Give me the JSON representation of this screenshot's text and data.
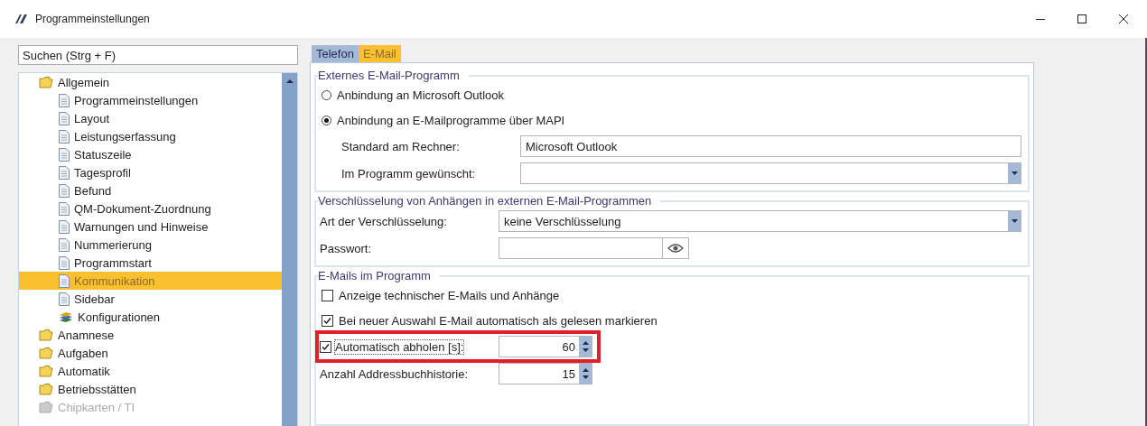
{
  "window": {
    "title": "Programmeinstellungen"
  },
  "search": {
    "placeholder": "Suchen (Strg + F)"
  },
  "tree": [
    {
      "label": "Allgemein",
      "kind": "folder",
      "selected": false,
      "disabled": false,
      "children": [
        {
          "label": "Programmeinstellungen",
          "kind": "page",
          "selected": false,
          "disabled": false
        },
        {
          "label": "Layout",
          "kind": "page",
          "selected": false,
          "disabled": false
        },
        {
          "label": "Leistungserfassung",
          "kind": "page",
          "selected": false,
          "disabled": false
        },
        {
          "label": "Statuszeile",
          "kind": "page",
          "selected": false,
          "disabled": false
        },
        {
          "label": "Tagesprofil",
          "kind": "page",
          "selected": false,
          "disabled": false
        },
        {
          "label": "Befund",
          "kind": "page",
          "selected": false,
          "disabled": false
        },
        {
          "label": "QM-Dokument-Zuordnung",
          "kind": "page",
          "selected": false,
          "disabled": false
        },
        {
          "label": "Warnungen und Hinweise",
          "kind": "page",
          "selected": false,
          "disabled": false
        },
        {
          "label": "Nummerierung",
          "kind": "page",
          "selected": false,
          "disabled": false
        },
        {
          "label": "Programmstart",
          "kind": "page",
          "selected": false,
          "disabled": false
        },
        {
          "label": "Kommunikation",
          "kind": "page",
          "selected": true,
          "disabled": false
        },
        {
          "label": "Sidebar",
          "kind": "page",
          "selected": false,
          "disabled": false
        },
        {
          "label": "Konfigurationen",
          "kind": "stack",
          "selected": false,
          "disabled": false
        }
      ]
    },
    {
      "label": "Anamnese",
      "kind": "folder",
      "selected": false,
      "disabled": false
    },
    {
      "label": "Aufgaben",
      "kind": "folder",
      "selected": false,
      "disabled": false
    },
    {
      "label": "Automatik",
      "kind": "folder",
      "selected": false,
      "disabled": false
    },
    {
      "label": "Betriebsstätten",
      "kind": "folder",
      "selected": false,
      "disabled": false
    },
    {
      "label": "Chipkarten / TI",
      "kind": "folder",
      "selected": false,
      "disabled": true
    }
  ],
  "tabs": [
    {
      "label": "Telefon",
      "selected": false
    },
    {
      "label": "E-Mail",
      "selected": true
    }
  ],
  "groups": [
    {
      "title": "Externes E-Mail-Programm",
      "rows": [
        {
          "kind": "radio",
          "label": "Anbindung an Microsoft Outlook",
          "selected": false
        },
        {
          "kind": "radio",
          "label": "Anbindung an E-Mailprogramme über MAPI",
          "selected": true
        },
        {
          "kind": "field",
          "label": "Standard am Rechner:",
          "value": "Microsoft Outlook"
        },
        {
          "kind": "select",
          "label": "Im Programm gewünscht:"
        }
      ]
    },
    {
      "title": "Verschlüsselung von Anhängen in externen E-Mail-Programmen",
      "rows": [
        {
          "kind": "select",
          "label": "Art der Verschlüsselung:",
          "value": "keine Verschlüsselung"
        },
        {
          "kind": "password",
          "label": "Passwort:"
        }
      ]
    },
    {
      "title": "E-Mails im Programm",
      "rows": [
        {
          "kind": "checkbox",
          "label": "Anzeige technischer E-Mails und Anhänge",
          "checked": false
        },
        {
          "kind": "checkbox",
          "label": "Bei neuer Auswahl E-Mail automatisch als gelesen markieren",
          "checked": true
        },
        {
          "kind": "check-spinner",
          "label": "Automatisch abholen [s]:",
          "checked": true,
          "value": "60",
          "highlighted": true
        },
        {
          "kind": "spinner",
          "label": "Anzahl Addressbuchhistorie:",
          "value": "15"
        }
      ]
    }
  ]
}
